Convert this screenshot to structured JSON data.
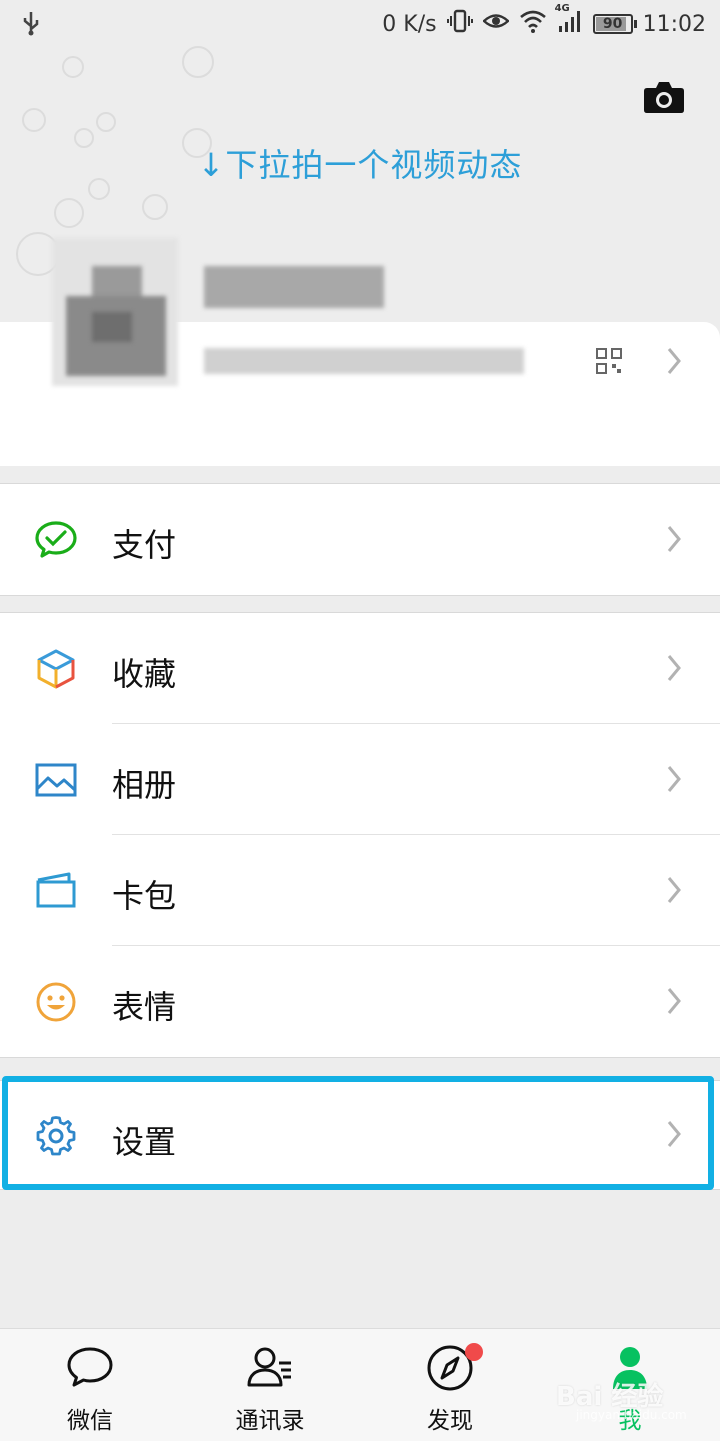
{
  "status_bar": {
    "net_speed": "0 K/s",
    "network_type": "4G",
    "battery": "90",
    "battery_level": 0.9,
    "time": "11:02"
  },
  "header": {
    "pull_hint": "↓下拉拍一个视频动态"
  },
  "menu": {
    "pay": "支付",
    "favorites": "收藏",
    "album": "相册",
    "cards": "卡包",
    "stickers": "表情",
    "settings": "设置"
  },
  "tabs": {
    "chats": "微信",
    "contacts": "通讯录",
    "discover": "发现",
    "me": "我"
  },
  "watermark": {
    "main": "Bai 经验",
    "sub": "jingyan.baidu.com"
  },
  "colors": {
    "accent": "#2d9fd8",
    "highlight": "#12b0e4",
    "wechat_green": "#07c160",
    "badge": "#f04a4a"
  }
}
